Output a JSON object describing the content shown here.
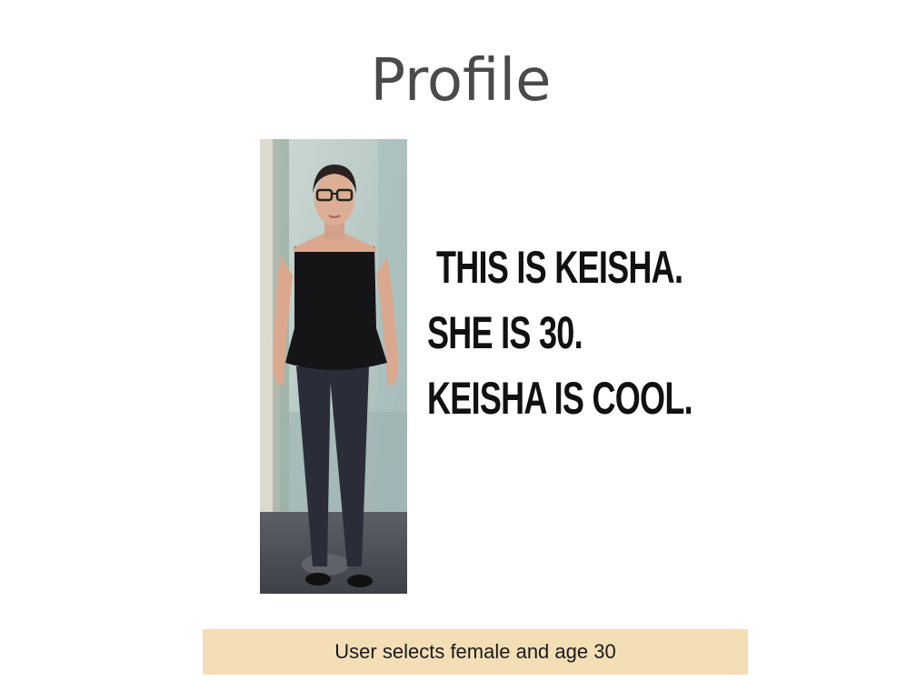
{
  "slide": {
    "title": "Profile",
    "caption_lines": [
      "This is Keisha.",
      "She is 30.",
      "Keisha is cool."
    ],
    "note": "User selects female and age 30"
  },
  "colors": {
    "title": "#4a4a4a",
    "caption": "#111111",
    "note_background": "#f4deb5",
    "background": "#ffffff"
  }
}
